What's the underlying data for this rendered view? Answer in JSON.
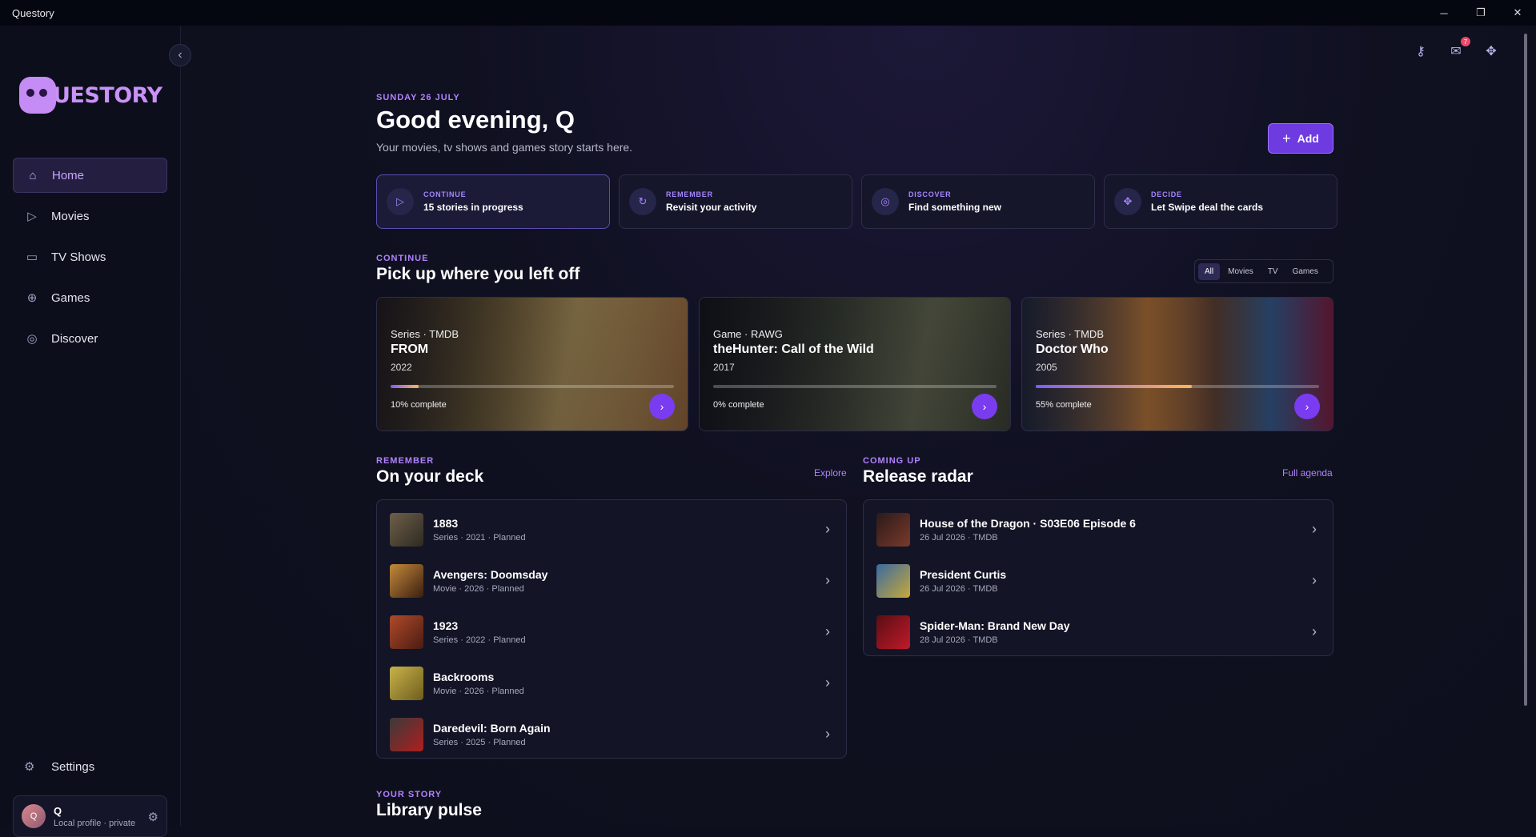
{
  "window": {
    "title": "Questory",
    "minimize": "─",
    "maximize": "❐",
    "close": "✕"
  },
  "sidebar": {
    "logo_text": "UESTORY",
    "collapse_glyph": "‹",
    "items": [
      {
        "label": "Home",
        "icon": "home-icon",
        "glyph": "⌂"
      },
      {
        "label": "Movies",
        "icon": "play-icon",
        "glyph": "▷"
      },
      {
        "label": "TV Shows",
        "icon": "tv-icon",
        "glyph": "▭"
      },
      {
        "label": "Games",
        "icon": "gamepad-icon",
        "glyph": "⊕"
      },
      {
        "label": "Discover",
        "icon": "discover-icon",
        "glyph": "◎"
      }
    ],
    "settings": {
      "label": "Settings",
      "glyph": "⚙"
    },
    "profile": {
      "initial": "Q",
      "name": "Q",
      "sub": "Local profile · private",
      "gear": "⚙"
    }
  },
  "topbar": {
    "badge_count": "7",
    "key_glyph": "⚷",
    "mail_glyph": "✉",
    "swipe_glyph": "✥"
  },
  "header": {
    "date": "SUNDAY 26 JULY",
    "greeting": "Good evening, Q",
    "subtitle": "Your movies, tv shows and games story starts here.",
    "add_plus": "+",
    "add_label": "Add"
  },
  "actions": [
    {
      "kicker": "CONTINUE",
      "value": "15 stories in progress",
      "glyph": "▷"
    },
    {
      "kicker": "REMEMBER",
      "value": "Revisit your activity",
      "glyph": "↻"
    },
    {
      "kicker": "DISCOVER",
      "value": "Find something new",
      "glyph": "◎"
    },
    {
      "kicker": "DECIDE",
      "value": "Let Swipe deal the cards",
      "glyph": "✥"
    }
  ],
  "continue": {
    "eyebrow": "CONTINUE",
    "title": "Pick up where you left off",
    "filters": [
      "All",
      "Movies",
      "TV",
      "Games"
    ],
    "cards": [
      {
        "meta": "Series · TMDB",
        "title": "FROM",
        "year": "2022",
        "progress": 0.1,
        "progress_label": "10% complete"
      },
      {
        "meta": "Game · RAWG",
        "title": "theHunter: Call of the Wild",
        "year": "2017",
        "progress": 0.0,
        "progress_label": "0% complete"
      },
      {
        "meta": "Series · TMDB",
        "title": "Doctor Who",
        "year": "2005",
        "progress": 0.55,
        "progress_label": "55% complete"
      }
    ]
  },
  "deck": {
    "eyebrow": "REMEMBER",
    "title": "On your deck",
    "link": "Explore",
    "items": [
      {
        "title": "1883",
        "sub": "Series · 2021 · Planned"
      },
      {
        "title": "Avengers: Doomsday",
        "sub": "Movie · 2026 · Planned"
      },
      {
        "title": "1923",
        "sub": "Series · 2022 · Planned"
      },
      {
        "title": "Backrooms",
        "sub": "Movie · 2026 · Planned"
      },
      {
        "title": "Daredevil: Born Again",
        "sub": "Series · 2025 · Planned"
      }
    ]
  },
  "radar": {
    "eyebrow": "COMING UP",
    "title": "Release radar",
    "link": "Full agenda",
    "items": [
      {
        "title": "House of the Dragon · S03E06 Episode 6",
        "sub": "26 Jul 2026 · TMDB"
      },
      {
        "title": "President Curtis",
        "sub": "26 Jul 2026 · TMDB"
      },
      {
        "title": "Spider-Man: Brand New Day",
        "sub": "28 Jul 2026 · TMDB"
      }
    ]
  },
  "story": {
    "eyebrow": "YOUR STORY",
    "title": "Library pulse"
  },
  "colors": {
    "accent": "#7a3cf0",
    "eyebrow": "#b182ff",
    "background": "#0e0f1c"
  }
}
